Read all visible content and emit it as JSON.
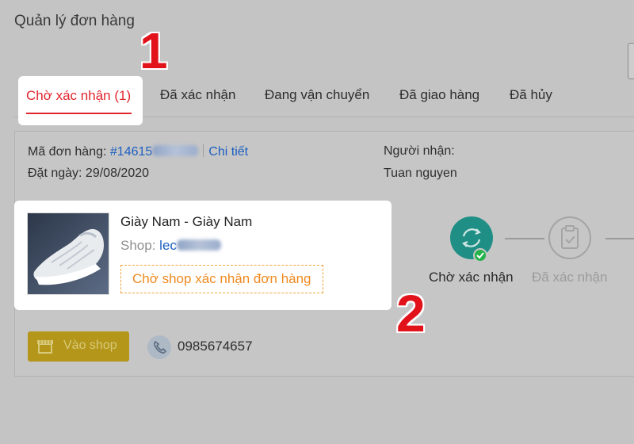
{
  "page": {
    "title": "Quản lý đơn hàng"
  },
  "tabs": [
    {
      "label": "Chờ xác nhận (1)",
      "active": true
    },
    {
      "label": "Đã xác nhận",
      "active": false
    },
    {
      "label": "Đang vận chuyển",
      "active": false
    },
    {
      "label": "Đã giao hàng",
      "active": false
    },
    {
      "label": "Đã hủy",
      "active": false
    }
  ],
  "annotations": {
    "callout_1": "1",
    "callout_2": "2"
  },
  "order": {
    "code_label": "Mã đơn hàng:",
    "code_prefix": "#14615",
    "detail_link": "Chi tiết",
    "date_text": "Đặt ngày: 29/08/2020",
    "recipient_label": "Người nhận:",
    "recipient_name": "Tuan nguyen"
  },
  "product": {
    "name": "Giày Nam - Giày Nam",
    "shop_label": "Shop:",
    "shop_name_prefix": "lec",
    "status_chip": "Chờ shop xác nhận đơn hàng"
  },
  "tracker": {
    "steps": [
      {
        "label": "Chờ xác nhận",
        "state": "current",
        "icon": "refresh-icon"
      },
      {
        "label": "Đã xác nhận",
        "state": "pending",
        "icon": "clipboard-check-icon"
      }
    ]
  },
  "actions": {
    "shop_button": "Vào shop",
    "phone": "0985674657"
  },
  "colors": {
    "accent_red": "#e0262e",
    "link_blue": "#1d5fc2",
    "chip_orange": "#ef8a21",
    "step_teal": "#1f8f86",
    "check_green": "#24b34a",
    "shop_button_yellow": "#b4961a"
  }
}
